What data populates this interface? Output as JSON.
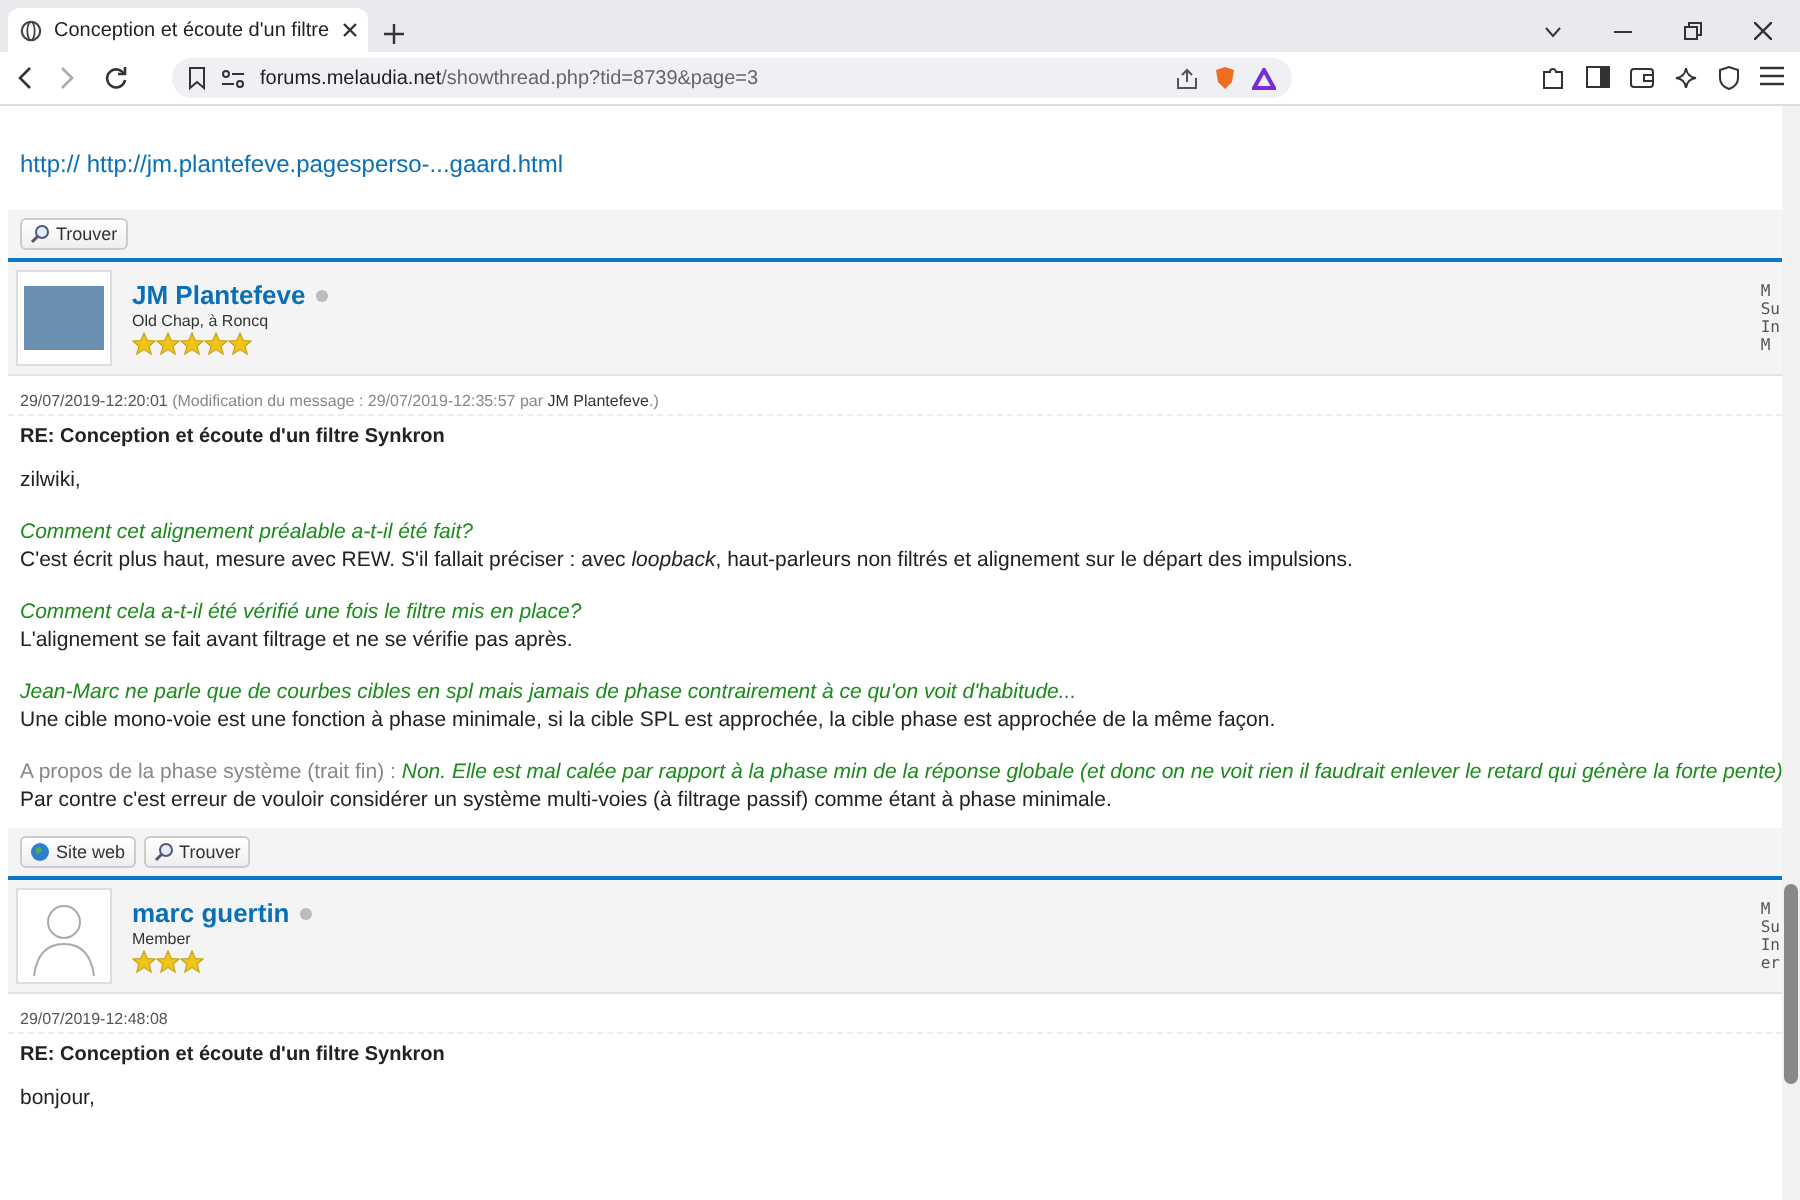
{
  "browser": {
    "tab_title": "Conception et écoute d'un filtre",
    "url_domain": "forums.melaudia.net",
    "url_path": "/showthread.php?tid=8739&page=3"
  },
  "prev_post": {
    "link": "http:// http://jm.plantefeve.pagesperso-...gaard.html",
    "buttons": [
      {
        "kind": "find",
        "label": "Trouver"
      }
    ]
  },
  "posts": [
    {
      "author": "JM Plantefeve",
      "online": false,
      "custom_avatar": true,
      "rank": "Old Chap, à Roncq",
      "stars": 5,
      "stats": [
        "M",
        "Su",
        "In",
        "M"
      ],
      "date": "29/07/2019-12:20:01",
      "edit_note": "(Modification du message : 29/07/2019-12:35:57 par ",
      "edit_by": "JM Plantefeve",
      "edit_end": ".)",
      "title": "RE: Conception et écoute d'un filtre Synkron",
      "body": [
        {
          "lines": [
            {
              "kind": "plain",
              "text": "zilwiki,"
            }
          ]
        },
        {
          "lines": [
            {
              "kind": "quote",
              "text": "Comment cet alignement préalable a-t-il été fait?"
            },
            {
              "kind": "plain",
              "text": "C'est écrit plus haut, mesure avec REW. S'il fallait préciser : avec *loopback*, haut-parleurs non filtrés et alignement sur le départ des impulsions."
            }
          ]
        },
        {
          "lines": [
            {
              "kind": "quote",
              "text": "Comment cela a-t-il été vérifié une fois le filtre mis en place?"
            },
            {
              "kind": "plain",
              "text": "L'alignement se fait avant filtrage et ne se vérifie pas après."
            }
          ]
        },
        {
          "lines": [
            {
              "kind": "quote",
              "text": "Jean-Marc ne parle que de courbes cibles en spl mais jamais de phase contrairement à ce qu'on voit d'habitude..."
            },
            {
              "kind": "plain",
              "text": "Une cible mono-voie est une fonction à phase minimale, si la cible SPL est approchée, la cible phase est approchée de la même façon."
            }
          ]
        },
        {
          "lines": [
            {
              "kind": "labeled",
              "label": "A propos de la phase système (trait fin) :",
              "text": "Non. Elle est mal calée par rapport à la phase min de la réponse globale (et donc on ne voit rien il faudrait enlever le retard qui génère la forte pente)"
            },
            {
              "kind": "plain",
              "text": "Par contre c'est erreur de vouloir considérer un système multi-voies (à filtrage passif) comme étant à phase minimale."
            }
          ]
        }
      ],
      "buttons": [
        {
          "kind": "website",
          "label": "Site web"
        },
        {
          "kind": "find",
          "label": "Trouver"
        }
      ]
    },
    {
      "author": "marc guertin",
      "online": false,
      "custom_avatar": false,
      "rank": "Member",
      "stars": 3,
      "stats": [
        "M",
        "Su",
        "In",
        "er"
      ],
      "date": "29/07/2019-12:48:08",
      "title": "RE: Conception et écoute d'un filtre Synkron",
      "body": [
        {
          "lines": [
            {
              "kind": "plain",
              "text": "bonjour,"
            }
          ]
        }
      ]
    }
  ]
}
